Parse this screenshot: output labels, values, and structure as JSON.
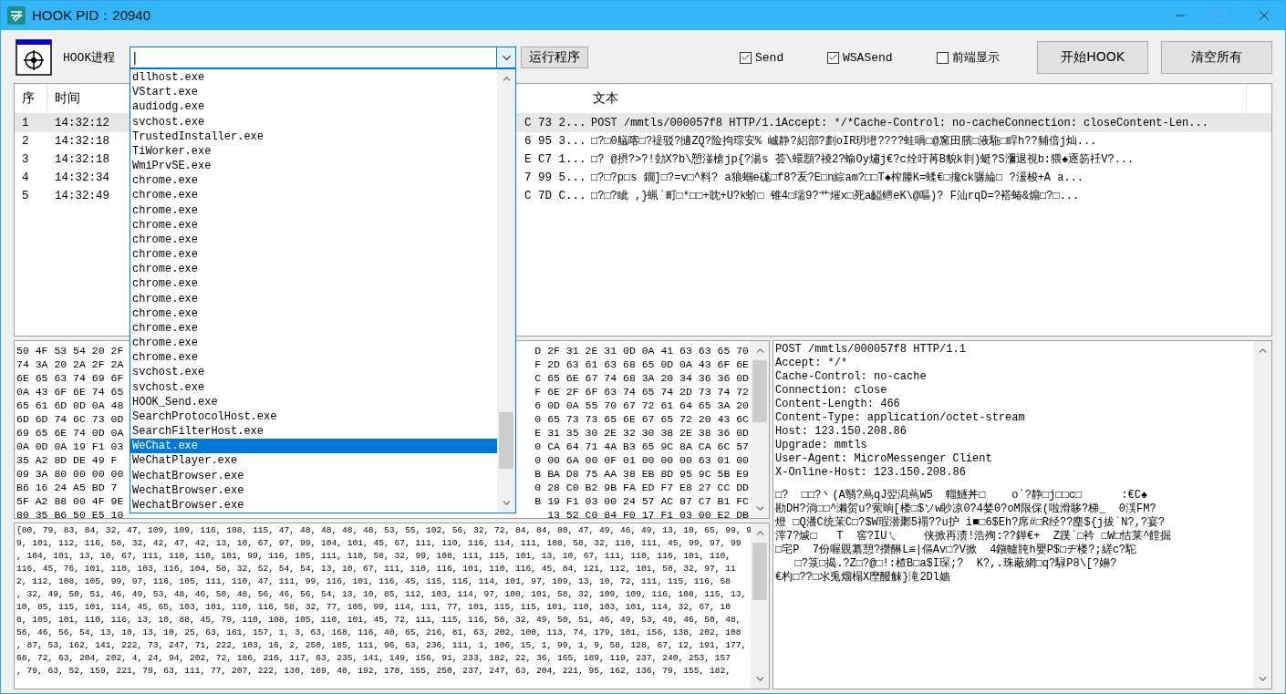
{
  "window": {
    "title": "HOOK PID：20940"
  },
  "toolbar": {
    "process_label": "HOOK进程",
    "process_value": "|",
    "run_button": "运行程序",
    "checkboxes": [
      {
        "label": "Send",
        "checked": true
      },
      {
        "label": "WSASend",
        "checked": true
      },
      {
        "label": "前端显示",
        "checked": false
      }
    ],
    "buttons": [
      "开始HOOK",
      "清空所有"
    ]
  },
  "process_dropdown": {
    "items": [
      {
        "label": "dllhost.exe",
        "selected": false
      },
      {
        "label": "VStart.exe",
        "selected": false
      },
      {
        "label": "audiodg.exe",
        "selected": false
      },
      {
        "label": "svchost.exe",
        "selected": false
      },
      {
        "label": "TrustedInstaller.exe",
        "selected": false
      },
      {
        "label": "TiWorker.exe",
        "selected": false
      },
      {
        "label": "WmiPrvSE.exe",
        "selected": false
      },
      {
        "label": "chrome.exe",
        "selected": false
      },
      {
        "label": "chrome.exe",
        "selected": false
      },
      {
        "label": "chrome.exe",
        "selected": false
      },
      {
        "label": "chrome.exe",
        "selected": false
      },
      {
        "label": "chrome.exe",
        "selected": false
      },
      {
        "label": "chrome.exe",
        "selected": false
      },
      {
        "label": "chrome.exe",
        "selected": false
      },
      {
        "label": "chrome.exe",
        "selected": false
      },
      {
        "label": "chrome.exe",
        "selected": false
      },
      {
        "label": "chrome.exe",
        "selected": false
      },
      {
        "label": "chrome.exe",
        "selected": false
      },
      {
        "label": "chrome.exe",
        "selected": false
      },
      {
        "label": "chrome.exe",
        "selected": false
      },
      {
        "label": "svchost.exe",
        "selected": false
      },
      {
        "label": "svchost.exe",
        "selected": false
      },
      {
        "label": "HOOK_Send.exe",
        "selected": false
      },
      {
        "label": "SearchProtocolHost.exe",
        "selected": false
      },
      {
        "label": "SearchFilterHost.exe",
        "selected": false
      },
      {
        "label": "WeChat.exe",
        "selected": true
      },
      {
        "label": "WeChatPlayer.exe",
        "selected": false
      },
      {
        "label": "WechatBrowser.exe",
        "selected": false
      },
      {
        "label": "WechatBrowser.exe",
        "selected": false
      },
      {
        "label": "WechatBrowser.exe",
        "selected": false
      }
    ]
  },
  "table": {
    "columns": [
      "序",
      "时间",
      "文本"
    ],
    "rows": [
      {
        "index": "1",
        "time": "14:32:12",
        "column_3": "C 73 2...",
        "text": "POST /mmtls/000057f8 HTTP/1.1Accept: */*Cache-Control: no-cacheConnection: closeContent-Len...",
        "selected": true
      },
      {
        "index": "2",
        "time": "14:32:18",
        "column_3": "6 95 3...",
        "text": "□?□0艤喀□?禔驳?擿ZQ?险拘琮安%  峸静?絽部?劃oIR玥墱????蛙喎□@窻田臏□液駞□睅h??豧倍j灿...",
        "selected": false
      },
      {
        "index": "3",
        "time": "14:32:18",
        "column_3": "E C7 1...",
        "text": "□? @摂?>?!勎X?b\\愬湴槍jp{?湯s 荟\\蠉顋?祾2?蝓Oy熽j€?c烇吁苒B貌k剕)蜓?S瀰退視b:猥♠逐笏祍V?...",
        "selected": false
      },
      {
        "index": "4",
        "time": "14:32:34",
        "column_3": "7 99 5...",
        "text": "□?□?p□s 鐗]□?=v□^料?  a狼蝈e硥□f8?叐?E□n綜am?□□T♠榨滕K=蝚€□攙ck骣綸□  ?湲梭+A a...",
        "selected": false
      },
      {
        "index": "5",
        "time": "14:32:49",
        "column_3": "C 7D C...",
        "text": "□?□?眦  ,}蝋`町□*□□+眈+U?k蚧□  锥4□瓀9?艹熣x□死a齸鳣eK\\@嘔)?  F汕rqD=?褡蝽&煽□?□...",
        "selected": false
      }
    ]
  },
  "hex_view": {
    "rows": [
      {
        "left": "50 4F 53 54 20 2F",
        "right": "D 2F 31 2E 31 0D 0A 41 63 63 65 70"
      },
      {
        "left": "74 3A 20 2A 2F 2A",
        "right": "F 2D 63 61 63 68 65 0D 0A 43 6F 6E"
      },
      {
        "left": "6E 65 63 74 69 6F",
        "right": "C 65 6E 67 74 68 3A 20 34 36 36 0D"
      },
      {
        "left": "0A 43 6F 6E 74 65",
        "right": "F 6E 2F 6F 63 74 65 74 2D 73 74 72"
      },
      {
        "left": "65 61 6D 0D 0A 48",
        "right": "6 0D 0A 55 70 67 72 61 64 65 3A 20"
      },
      {
        "left": "6D 6D 74 6C 73 0D",
        "right": "0 65 73 73 65 6E 67 65 72 20 43 6C"
      },
      {
        "left": "69 65 6E 74 0D 0A",
        "right": "E 31 35 30 2E 32 30 38 2E 38 36 0D"
      },
      {
        "left": "0A 0D 0A 19 F1 03",
        "right": "0 CA 64 71 4A B3 65 9C 8A CA 6C 57"
      },
      {
        "left": "35 A2 8D DE 49 F",
        "right": "0 00 6A 00 0F 01 00 00 00 63 01 00"
      },
      {
        "left": "09 3A 80 00 00 00",
        "right": "B BA D8 75 AA 38 EB 8D 95 9C 5B E9"
      },
      {
        "left": "B6 16 24 A5 BD 7",
        "right": "0 28 C0 B2 9B FA ED F7 E8 27 CC DD"
      },
      {
        "left": "5F A2 88 00 4F 9E",
        "right": "B 19 F1 03 00 24 57 AC 87 C7 B1 FC"
      },
      {
        "left": "80 35 B6 50 E5 10",
        "right": "13 52 C0 84 F0 17 F1 03 00 E2 DB"
      }
    ]
  },
  "decimal_view": {
    "lines": [
      "{80, 79, 83, 84, 32, 47, 109, 109, 116, 108, 115, 47, 48, 48, 48, 48, 53, 55, 102, 56, 32, 72, 84, 84, 80, 47, 49, 46, 49, 13, 10, 65, 99, 9",
      "9, 101, 112, 116, 58, 32, 42, 47, 42, 13, 10, 67, 97, 99, 104, 101, 45, 67, 111, 110, 116, 114, 111, 108, 58, 32, 110, 111, 45, 99, 97, 99",
      ", 104, 101, 13, 10, 67, 111, 110, 110, 101, 99, 116, 105, 111, 110, 58, 32, 99, 108, 111, 115, 101, 13, 10, 67, 111, 110, 116, 101, 110,",
      "116, 45, 76, 101, 110, 103, 116, 104, 58, 32, 52, 54, 54, 13, 10, 67, 111, 110, 116, 101, 110, 116, 45, 84, 121, 112, 101, 58, 32, 97, 11",
      "2, 112, 108, 105, 99, 97, 116, 105, 111, 110, 47, 111, 99, 116, 101, 116, 45, 115, 116, 114, 101, 97, 109, 13, 10, 72, 111, 115, 116, 58",
      ", 32, 49, 50, 51, 46, 49, 53, 48, 46, 50, 48, 56, 46, 56, 54, 13, 10, 85, 112, 103, 114, 97, 100, 101, 58, 32, 109, 109, 116, 108, 115, 13,",
      "10, 85, 115, 101, 114, 45, 65, 103, 101, 110, 116, 58, 32, 77, 105, 99, 114, 111, 77, 101, 115, 115, 101, 110, 103, 101, 114, 32, 67, 10",
      "8, 105, 101, 110, 116, 13, 10, 88, 45, 79, 110, 108, 105, 110, 101, 45, 72, 111, 115, 116, 58, 32, 49, 50, 51, 46, 49, 53, 48, 46, 50, 48,",
      "56, 46, 56, 54, 13, 10, 13, 10, 25, 63, 161, 157, 1, 3, 63, 168, 116, 40, 65, 216, 81, 63, 202, 100, 113, 74, 179, 101, 156, 138, 202, 108",
      ", 87, 53, 162, 141, 222, 73, 247, 71, 222, 103, 16, 2, 250, 185, 111, 96, 63, 236, 111, 1, 106, 15, 1, 99, 1, 9, 58, 128, 67, 12, 191, 177,",
      "68, 72, 63, 204, 202, 4, 24, 94, 202, 72, 186, 216, 117, 63, 235, 141, 149, 156, 91, 233, 182, 22, 36, 165, 189, 119, 237, 240, 253, 157",
      ", 79, 63, 52, 159, 221, 79, 63, 111, 77, 207, 222, 130, 189, 40, 192, 178, 155, 250, 237, 247, 63, 204, 221, 95, 162, 136, 79, 155, 182,"
    ]
  },
  "text_view": {
    "headers": [
      "POST /mmtls/000057f8 HTTP/1.1",
      "Accept: */*",
      "Cache-Control: no-cache",
      "Connection: close",
      "Content-Length: 466",
      "Content-Type: application/octet-stream",
      "Host: 123.150.208.86",
      "Upgrade: mmtls",
      "User-Agent: MicroMessenger Client",
      "X-Online-Host: 123.150.208.86"
    ],
    "body": [
      "□?  □□?丶(A翳?蔦qJ翌潟蔦W5  輜鱁丼□    o`?静□j□□c□      :€C♠",
      "勘DH?淌□□^濑贺u?蒬晌[楼□$ソw眇凉0?4婪0?oM限倸(啦滑眵?梯_  0渓FM?",
      "燈 □Q潘C统茉C□?$W瑕潜鄹5禤??u护 i■□6$Eh?席#□R经??塵${j拔`N?,?宴?",
      "滓7?煘□   T  窖?IUㄟ    侠掀再渍!浩殉:??鏵€+  Z蹼`□衿 □W□怙莱^饄掘",
      "□宅P  7份喔覞纂憩?攒醂L≌|傴Av□?V掀  4鏹轤肫h嬰P$□ヂ楼?;縒c?駝",
      "   □?箓□揭.?Z□?@□!:楂B□a$I琛;?  K?,.珠蔽網□q?騄P8\\[?嬶?",
      "€杓□??□氺兎熘榻X塺醱觫}滝2Dl嫱"
    ]
  }
}
